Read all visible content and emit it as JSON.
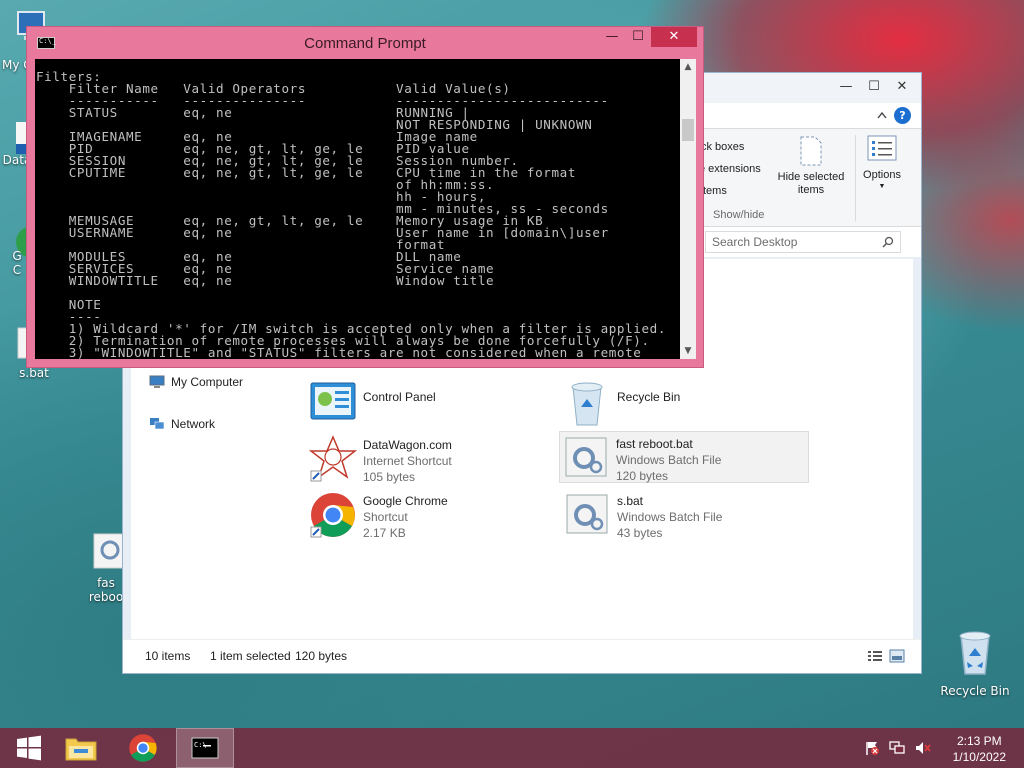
{
  "desktop": {
    "icons": [
      {
        "label": "My C"
      },
      {
        "label": "Data"
      },
      {
        "label": "G\nC"
      },
      {
        "label": "s.bat"
      },
      {
        "label": "fas\nreboo"
      },
      {
        "label": "Recycle Bin"
      }
    ]
  },
  "cmd": {
    "title": "Command Prompt",
    "console_lines": [
      "Filters:",
      "    Filter Name   Valid Operators           Valid Value(s)",
      "    -----------   ---------------           --------------------------",
      "    STATUS        eq, ne                    RUNNING |",
      "                                            NOT RESPONDING | UNKNOWN",
      "    IMAGENAME     eq, ne                    Image name",
      "    PID           eq, ne, gt, lt, ge, le    PID value",
      "    SESSION       eq, ne, gt, lt, ge, le    Session number.",
      "    CPUTIME       eq, ne, gt, lt, ge, le    CPU time in the format",
      "                                            of hh:mm:ss.",
      "                                            hh - hours,",
      "                                            mm - minutes, ss - seconds",
      "    MEMUSAGE      eq, ne, gt, lt, ge, le    Memory usage in KB",
      "    USERNAME      eq, ne                    User name in [domain\\]user",
      "                                            format",
      "    MODULES       eq, ne                    DLL name",
      "    SERVICES      eq, ne                    Service name",
      "    WINDOWTITLE   eq, ne                    Window title",
      "",
      "    NOTE",
      "    ----",
      "    1) Wildcard '*' for /IM switch is accepted only when a filter is applied.",
      "    2) Termination of remote processes will always be done forcefully (/F).",
      "    3) \"WINDOWTITLE\" and \"STATUS\" filters are not considered when a remote"
    ],
    "minimize": "—",
    "maximize": "☐",
    "close": "✕"
  },
  "explorer": {
    "ribbon": {
      "checkboxes": "ck boxes",
      "extensions": "e extensions",
      "items": "tems",
      "hide_selected": "Hide selected\nitems",
      "options": "Options",
      "group_label": "Show/hide"
    },
    "search_placeholder": "Search Desktop",
    "nav": [
      {
        "label": "My Computer"
      },
      {
        "label": "Network"
      }
    ],
    "files": [
      {
        "name": "Control Panel",
        "type": "",
        "size": ""
      },
      {
        "name": "Recycle Bin",
        "type": "",
        "size": ""
      },
      {
        "name": "DataWagon.com",
        "type": "Internet Shortcut",
        "size": "105 bytes"
      },
      {
        "name": "fast reboot.bat",
        "type": "Windows Batch File",
        "size": "120 bytes"
      },
      {
        "name": "Google Chrome",
        "type": "Shortcut",
        "size": "2.17 KB"
      },
      {
        "name": "s.bat",
        "type": "Windows Batch File",
        "size": "43 bytes"
      }
    ],
    "status": {
      "count": "10 items",
      "selected": "1 item selected",
      "size": "120 bytes"
    }
  },
  "taskbar": {
    "time": "2:13 PM",
    "date": "1/10/2022"
  }
}
